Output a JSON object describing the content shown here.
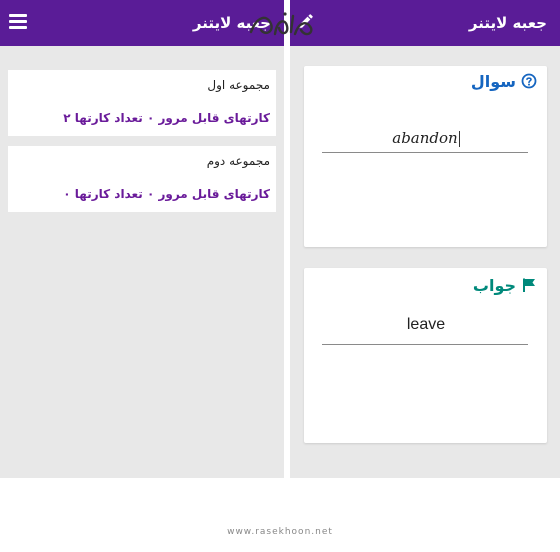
{
  "left_screen": {
    "app_title": "جعبه لایتنر",
    "decks": [
      {
        "name": "مجموعه اول",
        "info": "کارتهای قابل مرور ۰ تعداد کارتها ۲"
      },
      {
        "name": "مجموعه دوم",
        "info": "کارتهای قابل مرور ۰ تعداد کارتها ۰"
      }
    ]
  },
  "right_screen": {
    "app_title": "جعبه لایتنر",
    "question_card": {
      "label": "سوال",
      "value": "abandon",
      "icon": "help-circle-icon"
    },
    "answer_card": {
      "label": "جواب",
      "value": "leave",
      "icon": "flag-icon"
    }
  },
  "footer": {
    "site": "www.rasekhoon.net"
  },
  "colors": {
    "appbar": "#5a1c97",
    "deck_info": "#6a1b9a",
    "question_label": "#1565c0",
    "answer_label": "#00897b",
    "background": "#e8e8e8"
  }
}
